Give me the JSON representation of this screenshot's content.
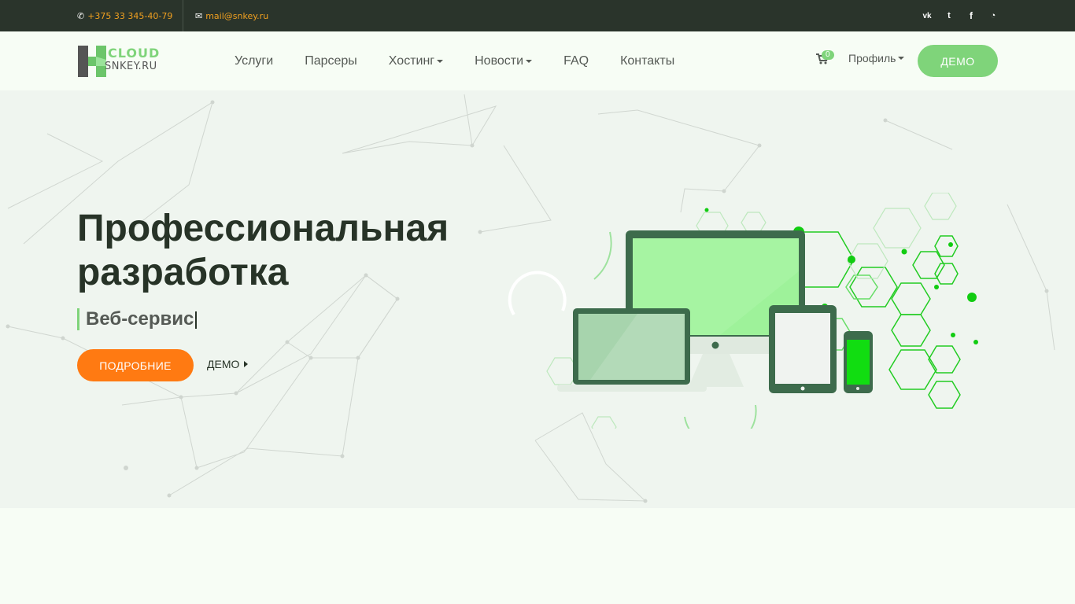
{
  "topbar": {
    "phone": "+375 33 345-40-79",
    "email": "mail@snkey.ru",
    "social": [
      "vk-icon",
      "twitter-icon",
      "facebook-icon",
      "rss-icon"
    ],
    "social_glyphs": [
      "vk",
      "🐦",
      "f",
      "◠"
    ]
  },
  "header": {
    "logo_top": "CLOUD",
    "logo_bottom": "SNKEY.RU",
    "nav": [
      "Услуги",
      "Парсеры",
      "Хостинг",
      "Новости",
      "FAQ",
      "Контакты"
    ],
    "cart_count": "0",
    "profile_label": "Профиль",
    "demo_label": "ДЕМО"
  },
  "hero": {
    "title_line1": "Профессиональная",
    "title_line2": "разработка",
    "subtitle": "Веб-сервис",
    "more_label": "ПОДРОБНИЕ",
    "demo_label": "ДЕМО"
  },
  "colors": {
    "topbar": "#2a342b",
    "accent": "#7fd47a",
    "orange": "#ff7a12",
    "text_dark": "#273327"
  }
}
